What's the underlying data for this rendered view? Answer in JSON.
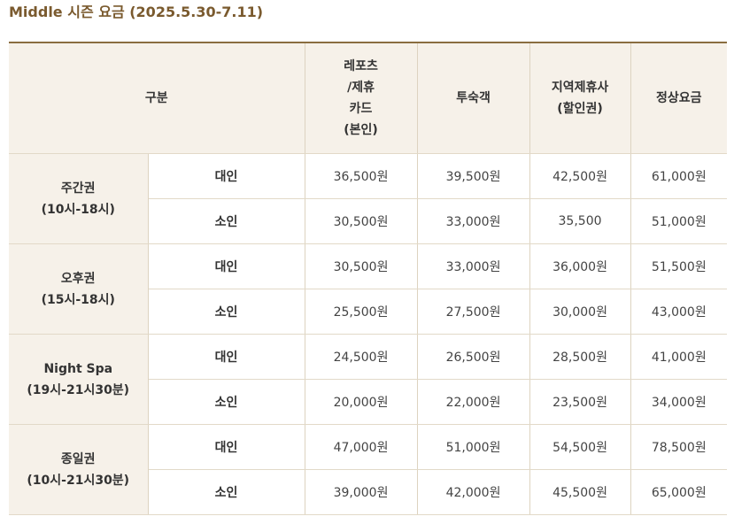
{
  "title": "Middle 시즌 요금 (2025.5.30-7.11)",
  "header": {
    "category": "구분",
    "columns": [
      [
        "레포츠",
        "/제휴",
        "카드",
        "(본인)"
      ],
      [
        "투숙객"
      ],
      [
        "지역제휴사",
        "(할인권)"
      ],
      [
        "정상요금"
      ]
    ]
  },
  "groups": [
    {
      "name": "주간권",
      "hours": "(10시-18시)",
      "rows": [
        {
          "type": "대인",
          "prices": [
            "36,500원",
            "39,500원",
            "42,500원",
            "61,000원"
          ]
        },
        {
          "type": "소인",
          "prices": [
            "30,500원",
            "33,000원",
            "35,500",
            "51,000원"
          ]
        }
      ]
    },
    {
      "name": "오후권",
      "hours": "(15시-18시)",
      "rows": [
        {
          "type": "대인",
          "prices": [
            "30,500원",
            "33,000원",
            "36,000원",
            "51,500원"
          ]
        },
        {
          "type": "소인",
          "prices": [
            "25,500원",
            "27,500원",
            "30,000원",
            "43,000원"
          ]
        }
      ]
    },
    {
      "name": "Night Spa",
      "hours": "(19시-21시30분)",
      "rows": [
        {
          "type": "대인",
          "prices": [
            "24,500원",
            "26,500원",
            "28,500원",
            "41,000원"
          ]
        },
        {
          "type": "소인",
          "prices": [
            "20,000원",
            "22,000원",
            "23,500원",
            "34,000원"
          ]
        }
      ]
    },
    {
      "name": "종일권",
      "hours": "(10시-21시30분)",
      "rows": [
        {
          "type": "대인",
          "prices": [
            "47,000원",
            "51,000원",
            "54,500원",
            "78,500원"
          ]
        },
        {
          "type": "소인",
          "prices": [
            "39,000원",
            "42,000원",
            "45,500원",
            "65,000원"
          ]
        }
      ]
    }
  ]
}
